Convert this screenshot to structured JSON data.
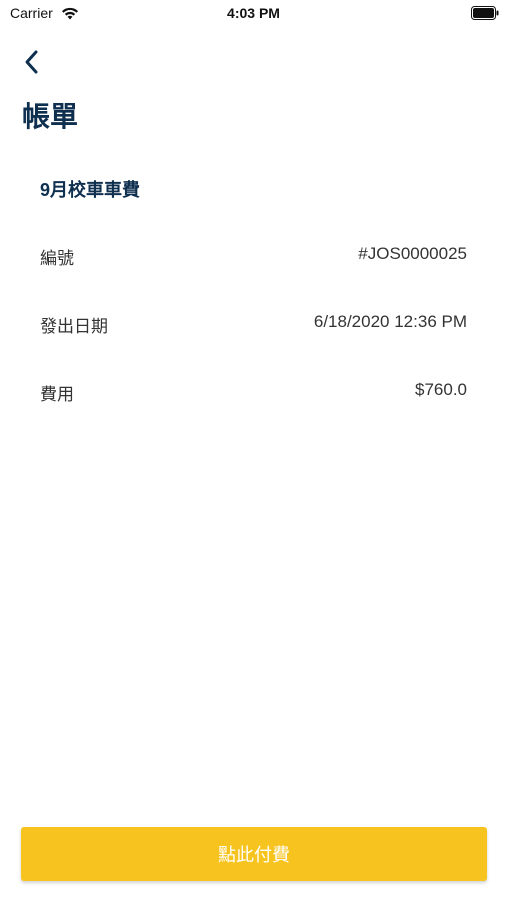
{
  "status_bar": {
    "carrier": "Carrier",
    "time": "4:03 PM"
  },
  "header": {
    "back_icon": "chevron-left-icon",
    "title": "帳單"
  },
  "bill": {
    "name": "9月校車車費",
    "rows": [
      {
        "label": "編號",
        "value": "#JOS0000025"
      },
      {
        "label": "發出日期",
        "value": "6/18/2020 12:36 PM"
      },
      {
        "label": "費用",
        "value": "$760.0"
      }
    ]
  },
  "actions": {
    "pay_label": "點此付費"
  },
  "colors": {
    "title": "#0f2f4f",
    "button": "#f7c31e",
    "button_text": "#ffffff"
  }
}
